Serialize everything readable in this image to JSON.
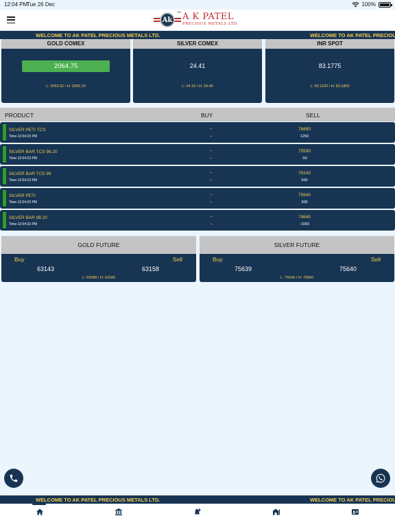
{
  "status_bar": {
    "time": "12:04 PM",
    "date": "Tue 26 Dec",
    "battery": "100%"
  },
  "brand": {
    "seal_letters": "Ak",
    "trademark": "TM",
    "name": "A K PATEL",
    "tagline": "PRECIOUS METALS LTD"
  },
  "ticker": {
    "message": "WELCOME TO AK PATEL PRECIOUS METALS LTD."
  },
  "rates": [
    {
      "title": "GOLD COMEX",
      "price": "2064.75",
      "range": "L: 2053.52 / H: 2065.10",
      "highlighted": true
    },
    {
      "title": "SILVER COMEX",
      "price": "24.41",
      "range": "L: 24.15 / H: 24.40",
      "highlighted": false
    },
    {
      "title": "INR SPOT",
      "price": "83.1775",
      "range": "L: 83.1100 / H: 83.1850",
      "highlighted": false
    }
  ],
  "product_table": {
    "headers": {
      "product": "PRODUCT",
      "buy": "BUY",
      "sell": "SELL"
    },
    "rows": [
      {
        "name": "SILVER PETI TCS",
        "time": "Time-12:04:23 PM",
        "buy": "--",
        "buy_diff": "--",
        "sell": "76890",
        "sell_diff": "1250"
      },
      {
        "name": "SILVER BAR TCS 98.20",
        "time": "Time-12:04:23 PM",
        "buy": "--",
        "buy_diff": "--",
        "sell": "75590",
        "sell_diff": "-50"
      },
      {
        "name": "SILVER BAR TCS 99",
        "time": "Time-12:04:23 PM",
        "buy": "--",
        "buy_diff": "--",
        "sell": "76140",
        "sell_diff": "500"
      },
      {
        "name": "SILVER PETI",
        "time": "Time-12:04:23 PM",
        "buy": "--",
        "buy_diff": "--",
        "sell": "75940",
        "sell_diff": "300"
      },
      {
        "name": "SILVER BAR 98.20",
        "time": "Time-12:04:23 PM",
        "buy": "--",
        "buy_diff": "--",
        "sell": "74640",
        "sell_diff": "-1000"
      }
    ]
  },
  "futures": [
    {
      "title": "GOLD FUTURE",
      "buy_label": "Buy",
      "sell_label": "Sell",
      "buy": "63143",
      "sell": "63158",
      "range": "L: 63088 / H: 63185"
    },
    {
      "title": "SILVER FUTURE",
      "buy_label": "Buy",
      "sell_label": "Sell",
      "buy": "75639",
      "sell": "75640",
      "range": "L: 75540 / H: 75650"
    }
  ],
  "bottom_nav": [
    {
      "icon": "home-icon",
      "active": true
    },
    {
      "icon": "bank-icon",
      "active": false
    },
    {
      "icon": "bell-plus-icon",
      "active": false
    },
    {
      "icon": "building-icon",
      "active": false
    },
    {
      "icon": "contact-card-icon",
      "active": false
    }
  ],
  "fab_icons": {
    "call": "phone-icon",
    "whatsapp": "whatsapp-icon"
  },
  "colors": {
    "navy": "#173453",
    "gold": "#f2cc4f",
    "green": "#4caf50",
    "grey_header": "#c4c4c4",
    "page_bg": "#ebf5fd",
    "brand_red": "#c0282d"
  }
}
